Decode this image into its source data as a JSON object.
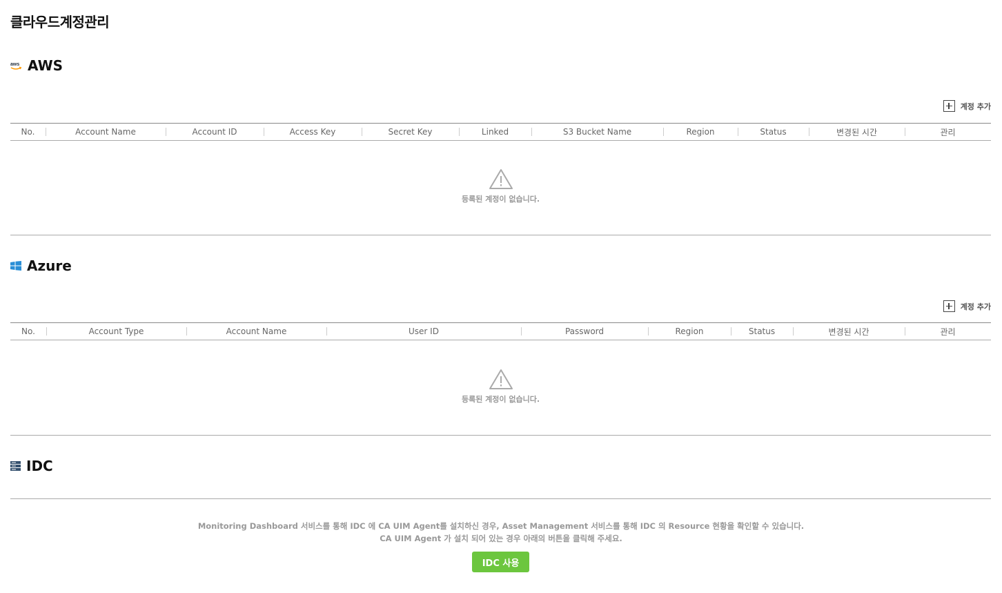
{
  "page": {
    "title": "클라우드계정관리"
  },
  "aws": {
    "title": "AWS",
    "icon_text": "aws",
    "add_label": "계정 추가",
    "columns": [
      "No.",
      "Account Name",
      "Account ID",
      "Access Key",
      "Secret Key",
      "Linked",
      "S3 Bucket Name",
      "Region",
      "Status",
      "변경된 시간",
      "관리"
    ],
    "empty_message": "등록된 계정이 없습니다."
  },
  "azure": {
    "title": "Azure",
    "add_label": "계정 추가",
    "columns": [
      "No.",
      "Account Type",
      "Account Name",
      "User ID",
      "Password",
      "Region",
      "Status",
      "변경된 시간",
      "관리"
    ],
    "empty_message": "등록된 계정이 없습니다."
  },
  "idc": {
    "title": "IDC",
    "message_line1": "Monitoring Dashboard 서비스를 통해 IDC 에 CA UIM Agent를 설치하신 경우, Asset Management 서비스를 통해 IDC 의 Resource 현황을 확인할 수 있습니다.",
    "message_line2": "CA UIM Agent 가 설치 되어 있는 경우 아래의 버튼을 클릭해 주세요.",
    "button_label": "IDC 사용",
    "button_color": "#6cc63e"
  },
  "colors": {
    "aws_orange": "#ff9900",
    "azure_blue": "#2b8fd6",
    "idc_navy": "#34506e"
  }
}
